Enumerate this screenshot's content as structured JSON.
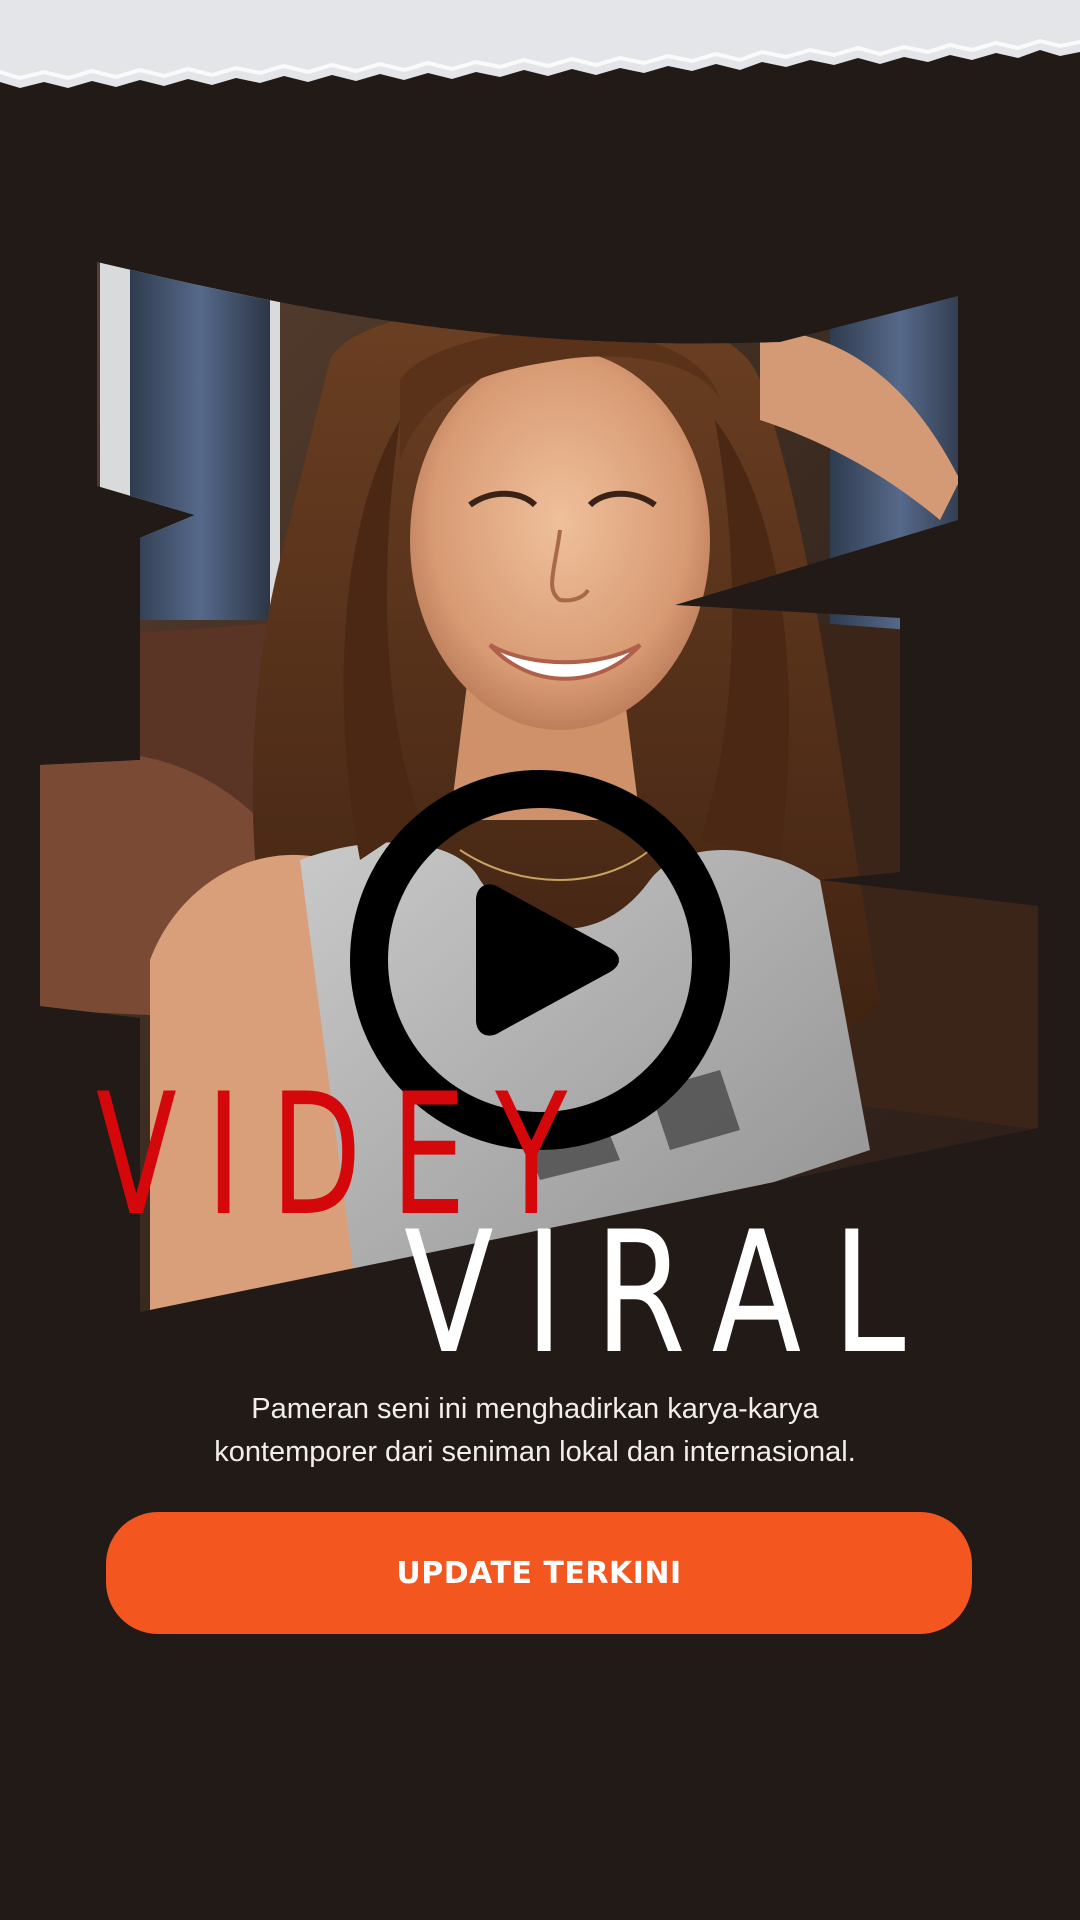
{
  "headline": {
    "word_1": "VIDEY",
    "word_2": "VIRAL"
  },
  "description": {
    "line_1": "Pameran seni ini menghadirkan karya-karya",
    "line_2": "kontemporer dari seniman lokal dan internasional."
  },
  "cta": {
    "label": "UPDATE TERKINI"
  },
  "icons": {
    "play": "play-icon"
  },
  "colors": {
    "background": "#211a16",
    "accent_red": "#d4070b",
    "cta_orange": "#f4561f",
    "text_light": "#ffffff",
    "paper": "#e3e5e8"
  }
}
